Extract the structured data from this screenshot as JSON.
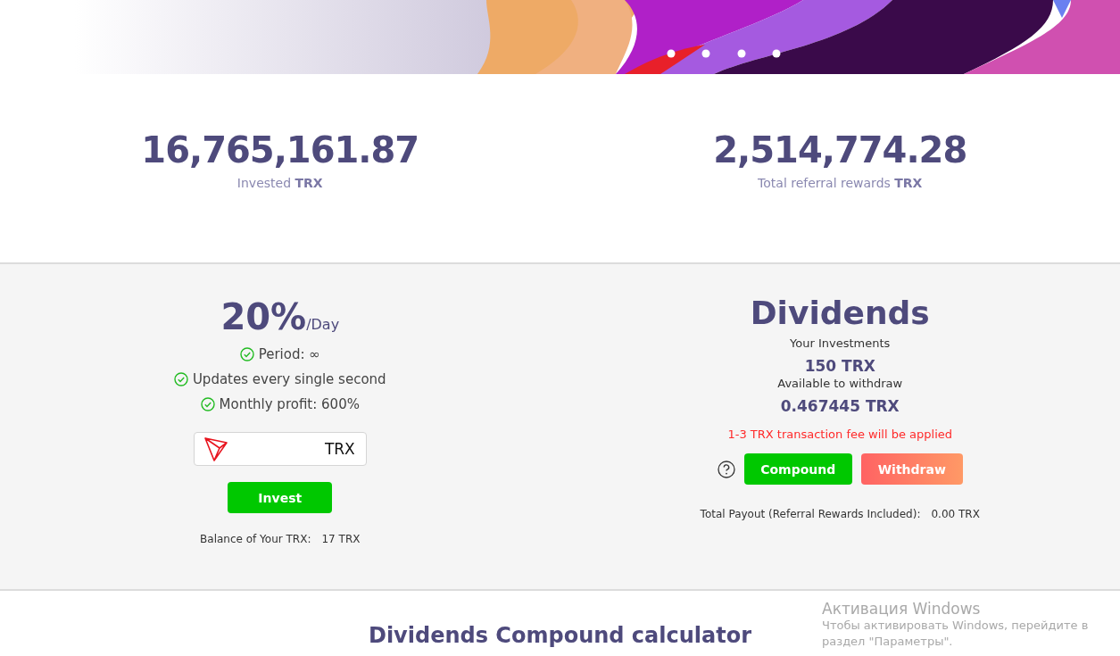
{
  "stats": [
    {
      "value": "16,765,161.87",
      "label": "Invested **TRX**"
    },
    {
      "value": "2,514,774.28",
      "label": "Total referral rewards **TRX**"
    }
  ],
  "plan": {
    "rate": "20%",
    "unit": "/Day",
    "features": [
      "Period: ∞",
      "Updates every single second",
      "Monthly profit: 600%"
    ],
    "amount_suffix": "TRX",
    "invest_button": "Invest",
    "balance_label": "Balance of Your TRX:",
    "balance_value": "17 TRX"
  },
  "dividends": {
    "title": "Dividends",
    "investments_label": "Your Investments",
    "investments_value": "150 TRX",
    "available_label": "Available to withdraw",
    "available_value": "0.467445 TRX",
    "fee_notice": "1-3 TRX transaction fee will be applied",
    "compound_button": "Compound",
    "withdraw_button": "Withdraw",
    "payout_label": "Total Payout (Referral Rewards Included):",
    "payout_value": "0.00 TRX"
  },
  "calculator": {
    "title": "Dividends Compound calculator"
  },
  "os_notice": {
    "title": "Активация Windows",
    "text": "Чтобы активировать Windows, перейдите в раздел \"Параметры\"."
  }
}
